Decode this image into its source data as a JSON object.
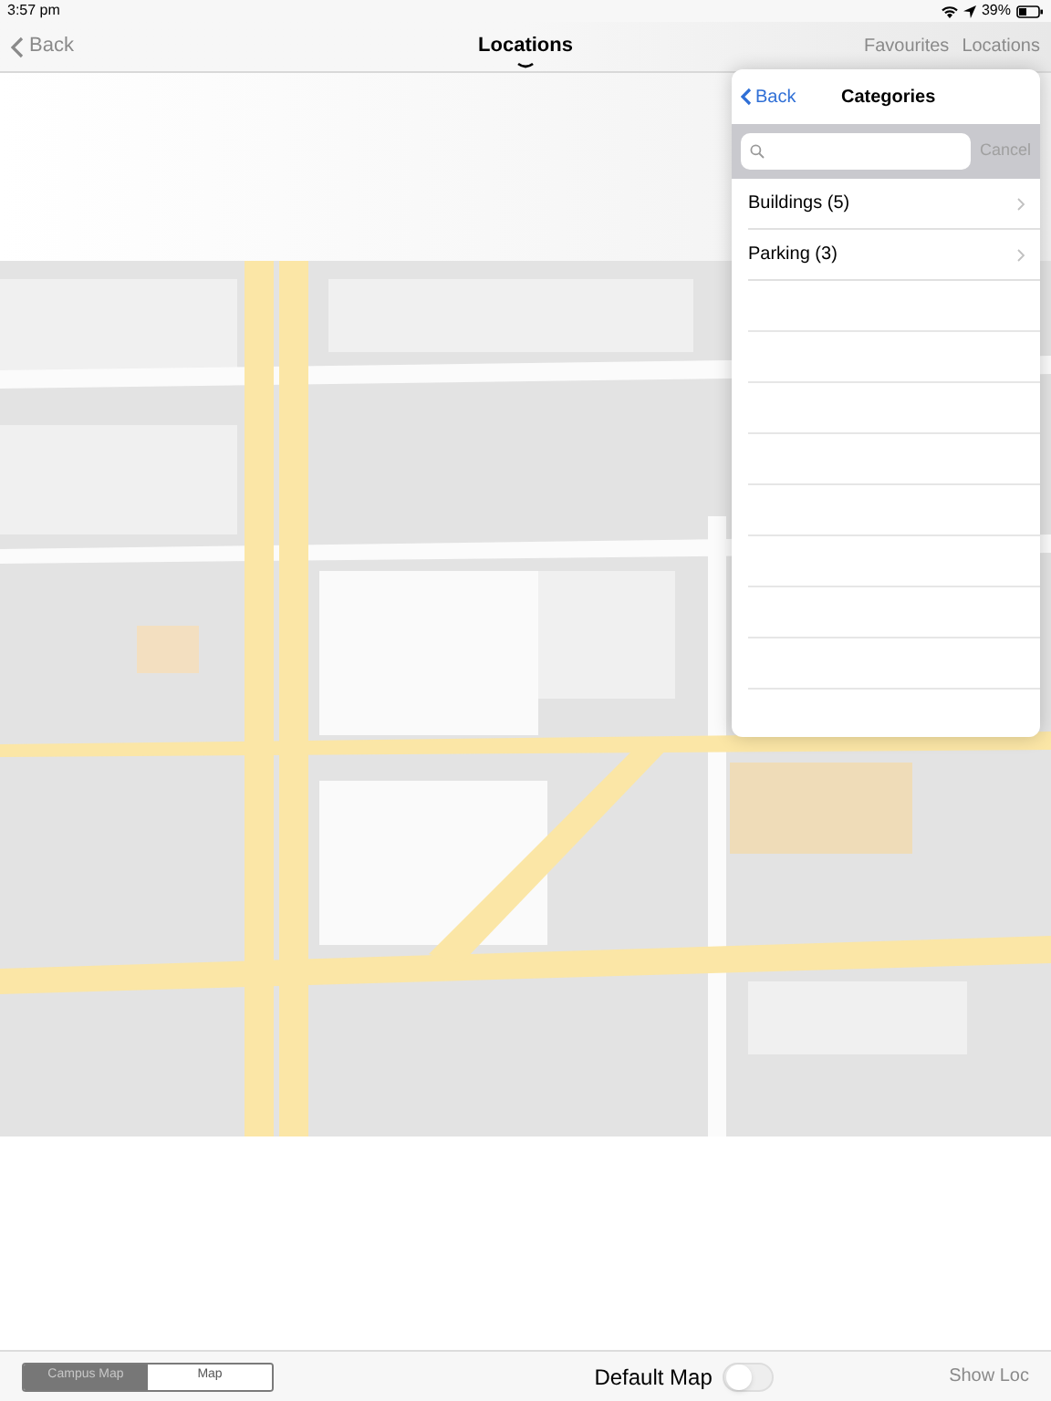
{
  "status_bar": {
    "time": "3:57 pm",
    "battery": "39%"
  },
  "nav_bar": {
    "back": "Back",
    "title": "Locations",
    "actions": [
      "Favourites",
      "Locations"
    ]
  },
  "popover": {
    "back": "Back",
    "title": "Categories",
    "search": {
      "cancel": "Cancel"
    },
    "items": [
      {
        "label": "Buildings (5)"
      },
      {
        "label": "Parking (3)"
      }
    ]
  },
  "bottom_bar": {
    "segments": [
      {
        "label": "Campus Map",
        "selected": true
      },
      {
        "label": "Map",
        "selected": false
      }
    ],
    "toggle": {
      "label": "Default Map",
      "on": false
    },
    "show_loc": "Show Loc"
  }
}
